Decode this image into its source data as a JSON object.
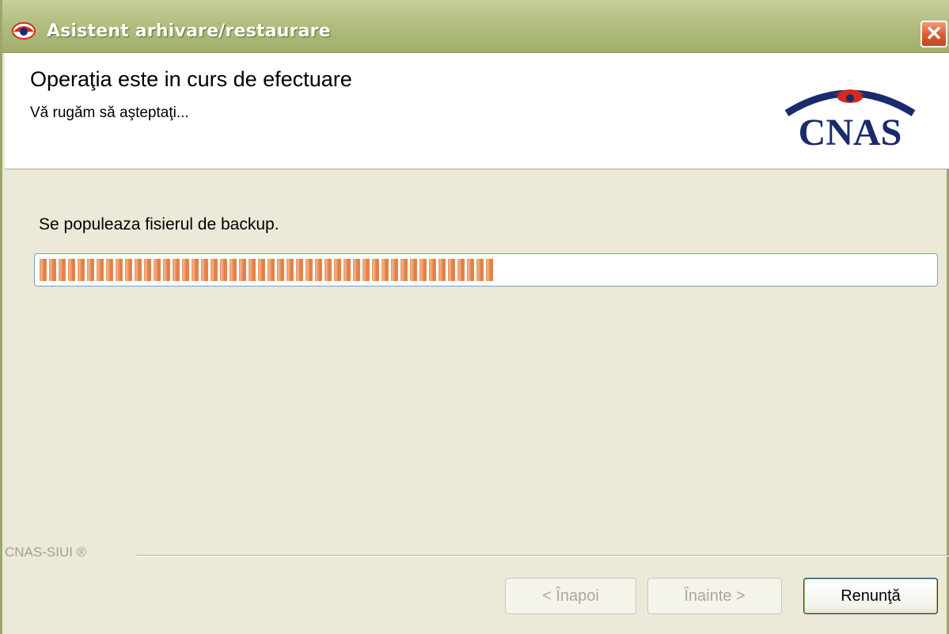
{
  "window": {
    "title": "Asistent arhivare/restaurare",
    "close_glyph": "✕"
  },
  "header": {
    "title": "Operaţia este in curs de efectuare",
    "subtitle": "Vă rugăm să aşteptaţi...",
    "logo_text": "CNAS"
  },
  "main": {
    "status": "Se populeaza fisierul de backup.",
    "progress_fraction": 0.51
  },
  "footer": {
    "branding": "CNAS-SIUI ®",
    "back_label": "< Înapoi",
    "next_label": "Înainte >",
    "cancel_label": "Renunţă"
  },
  "colors": {
    "progress": "#e98b53",
    "logo_blue": "#1a2a6c",
    "logo_red": "#d42a1f"
  },
  "icons": {
    "app_icon": "cnas-eye-icon",
    "close_icon": "close-icon"
  }
}
